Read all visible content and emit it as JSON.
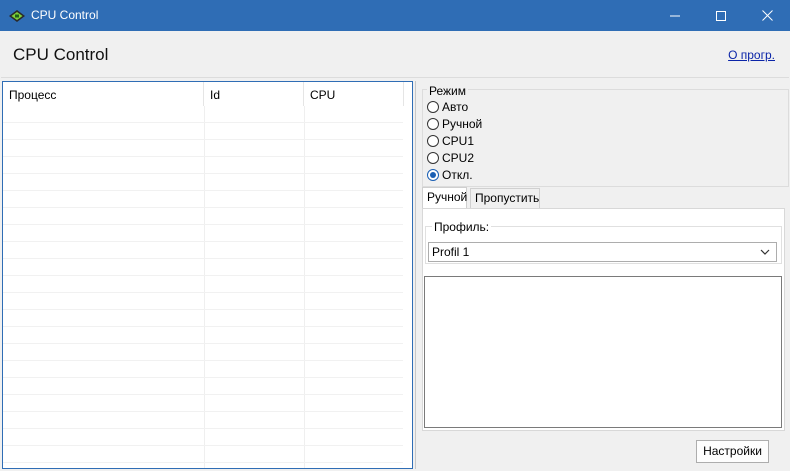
{
  "window": {
    "title": "CPU Control",
    "app_icon": "cpu-chip-icon",
    "controls": {
      "minimize_icon": "minimize-icon",
      "maximize_icon": "maximize-icon",
      "close_icon": "close-icon"
    },
    "titlebar_color": "#2f6db5"
  },
  "header": {
    "title": "CPU Control",
    "about_link": "О прогр."
  },
  "process_table": {
    "columns": [
      "Процесс",
      "Id",
      "CPU"
    ],
    "rows": [],
    "border_color": "#2f6db5"
  },
  "mode": {
    "legend": "Режим",
    "options": [
      {
        "label": "Авто",
        "checked": false
      },
      {
        "label": "Ручной",
        "checked": false
      },
      {
        "label": "CPU1",
        "checked": false
      },
      {
        "label": "CPU2",
        "checked": false
      },
      {
        "label": "Откл.",
        "checked": true
      }
    ]
  },
  "tabs": [
    {
      "label": "Ручной",
      "active": true
    },
    {
      "label": "Пропустить",
      "active": false
    }
  ],
  "manual": {
    "profile_legend": "Профиль:",
    "profile_selected": "Profil 1"
  },
  "settings_button": "Настройки"
}
